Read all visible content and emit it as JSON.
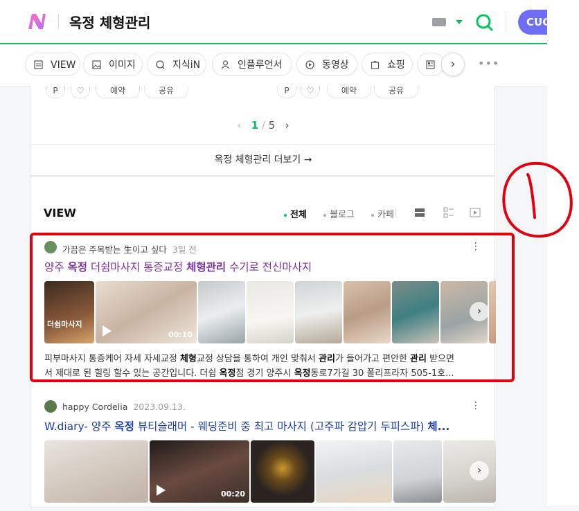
{
  "header": {
    "query": "옥정 체형관리",
    "profile_label": "CUG",
    "brand_color": "#03c75a",
    "icons": [
      "naver-logo-icon",
      "keyboard-icon",
      "dropdown-arrow-icon",
      "search-icon"
    ]
  },
  "tabs": [
    {
      "label": "VIEW",
      "icon": "view-icon"
    },
    {
      "label": "이미지",
      "icon": "image-icon"
    },
    {
      "label": "지식iN",
      "icon": "knowledge-icon"
    },
    {
      "label": "인플루언서",
      "icon": "person-icon"
    },
    {
      "label": "동영상",
      "icon": "play-icon"
    },
    {
      "label": "쇼핑",
      "icon": "shopping-icon"
    },
    {
      "label": "",
      "icon": "news-icon"
    }
  ],
  "upper_card": {
    "chips": [
      "예약",
      "공유",
      "예약",
      "공유"
    ],
    "pager": {
      "current": "1",
      "sep": "/",
      "total": "5"
    },
    "more_label": "옥정 체형관리 더보기 →"
  },
  "view_section": {
    "title": "VIEW",
    "filters": [
      "전체",
      "블로그",
      "카페"
    ],
    "active_filter": "전체"
  },
  "posts": [
    {
      "author": "가끔은 주목받는 生이고 싶다",
      "date": "3일 전",
      "title_parts": [
        "양주 ",
        "옥정",
        " 더쉼마사지 통증교정 ",
        "체형관리",
        " 수기로 전신마사지"
      ],
      "thumb_text": "더쉼마사지",
      "video_duration": "00:10",
      "snippet_line1": [
        "피부마사지 통증케어 자세 자세교정 ",
        "체형",
        "교정 상담을 통하여 개인 맞춰서 ",
        "관리",
        "가 들어가고 편안한 ",
        "관리",
        " 받으면"
      ],
      "snippet_line2": [
        "서 제대로 된 힐링 할수 있는 공간입니다. 더쉼 ",
        "옥정",
        "점 경기 양주시 ",
        "옥정",
        "동로7가길 30 폴리프라자 505-1호..."
      ]
    },
    {
      "author": "happy Cordelia",
      "date": "2023.09.13.",
      "title_parts": [
        "W.diary- 양주 ",
        "옥정",
        " 뷰티슬래머 - 웨딩준비 중 최고 마사지 (고주파 감압기 두피스파) ",
        "체..."
      ],
      "video_duration": "00:20"
    }
  ],
  "annotation": {
    "label": "1",
    "color": "#e2000f"
  }
}
